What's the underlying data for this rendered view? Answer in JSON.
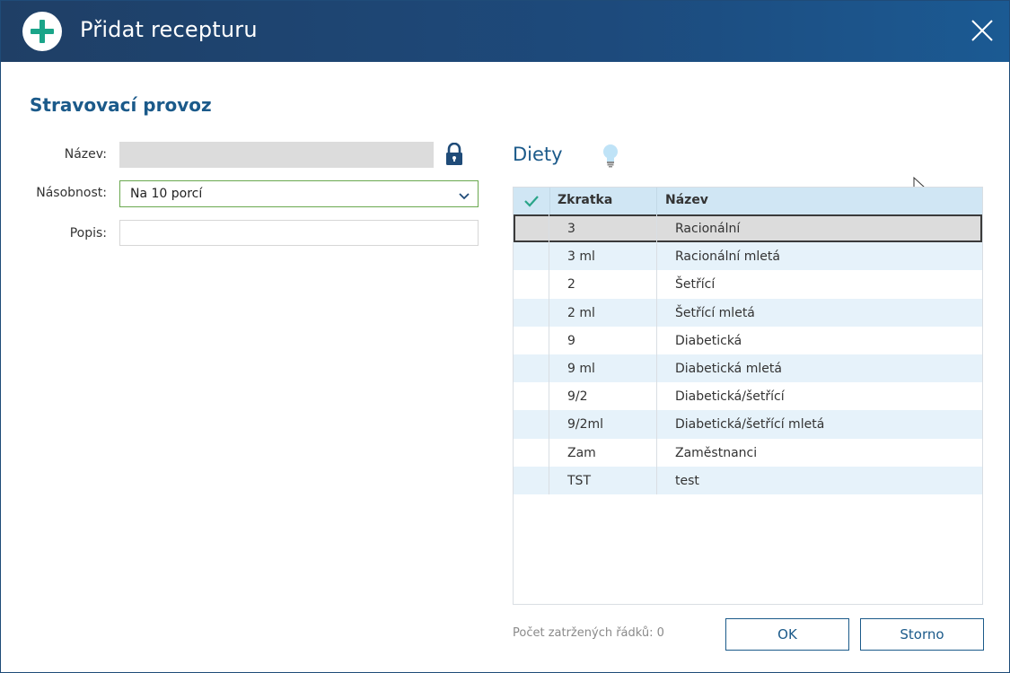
{
  "dialog": {
    "title": "Přidat recepturu",
    "title_icon": "add-circle-icon",
    "close_icon": "close-icon"
  },
  "form": {
    "section_title": "Stravovací provoz",
    "nazev_label": "Název:",
    "nazev_value": "",
    "nazev_locked_icon": "lock-icon",
    "nasobnost_label": "Násobnost:",
    "nasobnost_value": "Na 10 porcí",
    "popis_label": "Popis:",
    "popis_value": ""
  },
  "diety": {
    "title": "Diety",
    "hint_icon": "lightbulb-icon",
    "columns": {
      "check_icon": "checkmark-icon",
      "zkratka": "Zkratka",
      "nazev": "Název"
    },
    "rows": [
      {
        "zkratka": "3",
        "nazev": "Racionální",
        "selected": true
      },
      {
        "zkratka": "3 ml",
        "nazev": "Racionální mletá"
      },
      {
        "zkratka": "2",
        "nazev": "Šetřící"
      },
      {
        "zkratka": "2 ml",
        "nazev": "Šetřící mletá"
      },
      {
        "zkratka": "9",
        "nazev": "Diabetická"
      },
      {
        "zkratka": "9 ml",
        "nazev": "Diabetická mletá"
      },
      {
        "zkratka": "9/2",
        "nazev": "Diabetická/šetřící"
      },
      {
        "zkratka": "9/2ml",
        "nazev": "Diabetická/šetřící mletá"
      },
      {
        "zkratka": "Zam",
        "nazev": "Zaměstnanci"
      },
      {
        "zkratka": "TST",
        "nazev": "test"
      }
    ],
    "count_label": "Počet zatržených řádků: 0"
  },
  "buttons": {
    "ok": "OK",
    "storno": "Storno"
  },
  "colors": {
    "titlebar": "#1d4a7c",
    "accent": "#1b5a8a",
    "plus_icon": "#1aa589",
    "select_border": "#6aa84f",
    "header_row": "#d0e6f4",
    "alt_row": "#e6f2fa"
  }
}
